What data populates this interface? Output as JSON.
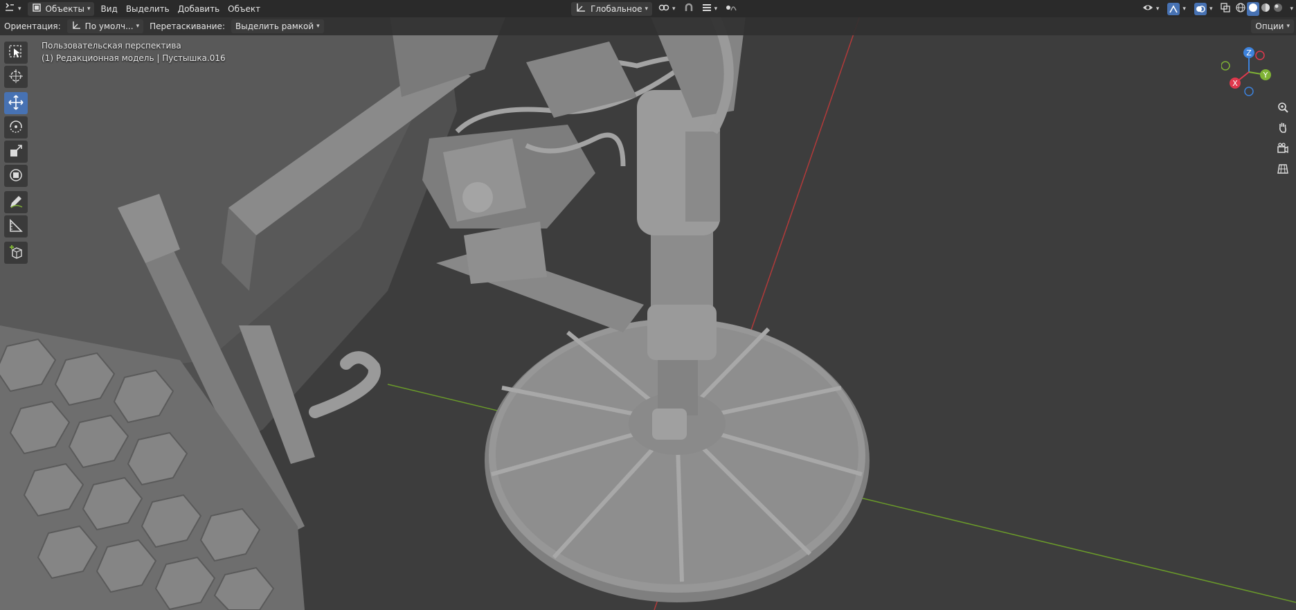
{
  "topbar": {
    "mode_label": "Объекты",
    "menu": [
      "Вид",
      "Выделить",
      "Добавить",
      "Объект"
    ],
    "transform_orientation": "Глобальное"
  },
  "subbar": {
    "orientation_label": "Ориентация:",
    "orientation_value": "По умолч...",
    "drag_label": "Перетаскивание:",
    "drag_value": "Выделить рамкой",
    "options_label": "Опции"
  },
  "viewport": {
    "view_name": "Пользовательская перспектива",
    "object_info": "(1) Редакционная модель | Пустышка.016"
  },
  "gizmo": {
    "z": "Z",
    "y": "Y",
    "x": "X"
  },
  "colors": {
    "active_tool": "#4772b3",
    "axis_x": "#e0394d",
    "axis_y": "#7fb235",
    "axis_z": "#3d82dc",
    "x_line": "#b33a3a",
    "y_line": "#6a9a2a"
  }
}
